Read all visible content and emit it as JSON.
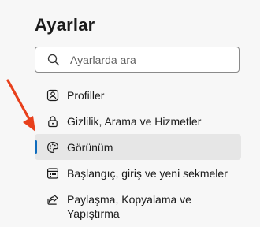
{
  "header": {
    "title": "Ayarlar"
  },
  "search": {
    "placeholder": "Ayarlarda ara",
    "value": "",
    "icon": "search-icon"
  },
  "sidebar": {
    "items": [
      {
        "label": "Profiller",
        "icon": "profile-icon",
        "selected": false
      },
      {
        "label": "Gizlilik, Arama ve Hizmetler",
        "icon": "lock-icon",
        "selected": false
      },
      {
        "label": "Görünüm",
        "icon": "palette-icon",
        "selected": true
      },
      {
        "label": "Başlangıç, giriş ve yeni sekmeler",
        "icon": "start-page-icon",
        "selected": false
      },
      {
        "label": "Paylaşma, Kopyalama ve Yapıştırma",
        "icon": "share-icon",
        "selected": false
      }
    ]
  },
  "annotation": {
    "arrow_color": "#e8401c",
    "points_to": "Görünüm"
  },
  "colors": {
    "accent": "#0f6cbd",
    "selected_background": "#e6e6e6",
    "page_background": "#f7f7f7",
    "arrow": "#e8401c"
  }
}
